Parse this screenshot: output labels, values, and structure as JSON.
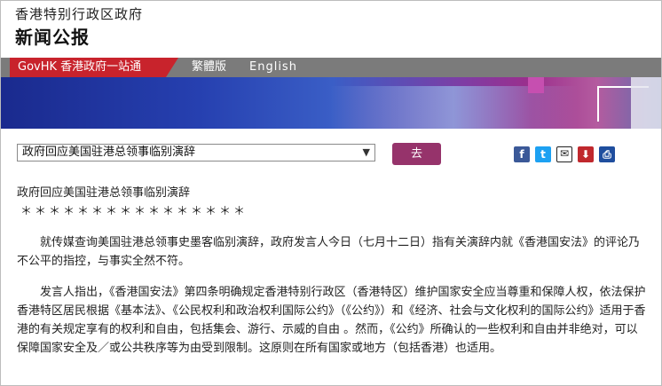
{
  "header": {
    "gov_name": "香港特别行政区政府",
    "section": "新闻公报"
  },
  "nav": {
    "home": "GovHK 香港政府一站通",
    "traditional": "繁體版",
    "english": "English"
  },
  "selector": {
    "selected": "政府回应美国驻港总领事临别演辞",
    "go_label": "去"
  },
  "tools": {
    "facebook": "f",
    "twitter": "t",
    "email": "✉",
    "download": "⬇",
    "print": "⎙"
  },
  "article": {
    "title": "政府回应美国驻港总领事临别演辞",
    "stars": "＊＊＊＊＊＊＊＊＊＊＊＊＊＊＊＊",
    "paragraphs": [
      "　　就传媒查询美国驻港总领事史墨客临别演辞，政府发言人今日（七月十二日）指有关演辞内就《香港国安法》的评论乃不公平的指控，与事实全然不符。",
      "　　发言人指出，《香港国安法》第四条明确规定香港特别行政区（香港特区）维护国家安全应当尊重和保障人权，依法保护香港特区居民根据《基本法》、《公民权利和政治权利国际公约》（《公约》）和《经济、社会与文化权利的国际公约》适用于香港的有关规定享有的权利和自由，包括集会、游行、示威的自由 。然而，《公约》所确认的一些权利和自由并非绝对，可以保障国家安全及／或公共秩序等为由受到限制。这原则在所有国家或地方（包括香港）也适用。"
    ]
  },
  "colors": {
    "nav_red": "#c8232c",
    "go_button": "#96336b",
    "nav_gray": "#7b7b7b"
  }
}
